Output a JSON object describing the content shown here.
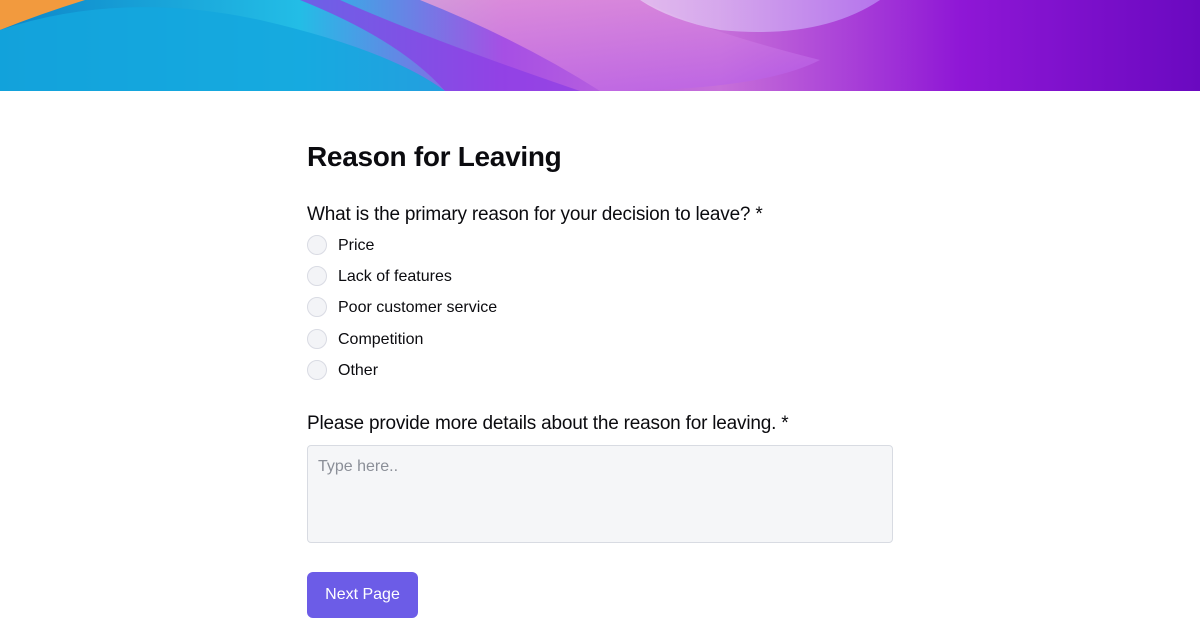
{
  "banner": {
    "colors": [
      "#f39a3c",
      "#1a8fd0",
      "#2ab7e3",
      "#b35ae6",
      "#9a22d9",
      "#6f0bc2"
    ]
  },
  "form": {
    "title": "Reason for Leaving",
    "question1": {
      "label": "What is the primary reason for your decision to leave? *",
      "options": [
        "Price",
        "Lack of features",
        "Poor customer service",
        "Competition",
        "Other"
      ]
    },
    "question2": {
      "label": "Please provide more details about the reason for leaving. *",
      "placeholder": "Type here..",
      "value": ""
    },
    "next_button_label": "Next Page",
    "accent_color": "#6c5ce7"
  }
}
